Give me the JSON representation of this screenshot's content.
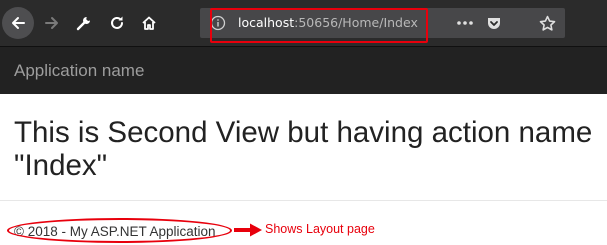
{
  "browser": {
    "url_host": "localhost",
    "url_path": ":50656/Home/Index",
    "icons": [
      "back-arrow-icon",
      "forward-arrow-icon",
      "wrench-icon",
      "reload-icon",
      "home-icon",
      "info-icon",
      "more-dots-icon",
      "pocket-icon",
      "star-icon"
    ]
  },
  "navbar": {
    "brand": "Application name"
  },
  "main": {
    "heading": "This is Second View but having action name \"Index\""
  },
  "footer": {
    "text": "© 2018 - My ASP.NET Application"
  },
  "annotation": {
    "callout": "Shows Layout page",
    "color": "#e8000c"
  },
  "colors": {
    "toolbar": "#2b2b2b",
    "urlbar": "#474749",
    "navbar": "#222222",
    "brand": "#9d9d9d"
  }
}
